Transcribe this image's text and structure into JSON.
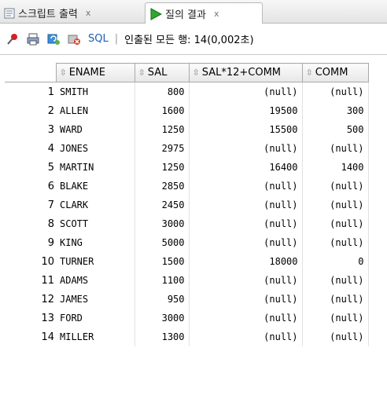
{
  "tabs": [
    {
      "label": "스크립트 출력",
      "close": "x",
      "icon": "script-output-icon"
    },
    {
      "label": "질의 결과",
      "close": "x",
      "icon": "run-icon"
    }
  ],
  "toolbar": {
    "icons": [
      "pin-icon",
      "print-icon",
      "refresh-icon",
      "cancel-icon"
    ],
    "sql_label": "SQL",
    "separator": "|",
    "status": "인출된 모든 행: 14(0,002초)"
  },
  "grid": {
    "columns": [
      "ENAME",
      "SAL",
      "SAL*12+COMM",
      "COMM"
    ],
    "rows": [
      {
        "n": "1",
        "ENAME": "SMITH",
        "SAL": "800",
        "CALC": "(null)",
        "COMM": "(null)"
      },
      {
        "n": "2",
        "ENAME": "ALLEN",
        "SAL": "1600",
        "CALC": "19500",
        "COMM": "300"
      },
      {
        "n": "3",
        "ENAME": "WARD",
        "SAL": "1250",
        "CALC": "15500",
        "COMM": "500"
      },
      {
        "n": "4",
        "ENAME": "JONES",
        "SAL": "2975",
        "CALC": "(null)",
        "COMM": "(null)"
      },
      {
        "n": "5",
        "ENAME": "MARTIN",
        "SAL": "1250",
        "CALC": "16400",
        "COMM": "1400"
      },
      {
        "n": "6",
        "ENAME": "BLAKE",
        "SAL": "2850",
        "CALC": "(null)",
        "COMM": "(null)"
      },
      {
        "n": "7",
        "ENAME": "CLARK",
        "SAL": "2450",
        "CALC": "(null)",
        "COMM": "(null)"
      },
      {
        "n": "8",
        "ENAME": "SCOTT",
        "SAL": "3000",
        "CALC": "(null)",
        "COMM": "(null)"
      },
      {
        "n": "9",
        "ENAME": "KING",
        "SAL": "5000",
        "CALC": "(null)",
        "COMM": "(null)"
      },
      {
        "n": "10",
        "ENAME": "TURNER",
        "SAL": "1500",
        "CALC": "18000",
        "COMM": "0"
      },
      {
        "n": "11",
        "ENAME": "ADAMS",
        "SAL": "1100",
        "CALC": "(null)",
        "COMM": "(null)"
      },
      {
        "n": "12",
        "ENAME": "JAMES",
        "SAL": "950",
        "CALC": "(null)",
        "COMM": "(null)"
      },
      {
        "n": "13",
        "ENAME": "FORD",
        "SAL": "3000",
        "CALC": "(null)",
        "COMM": "(null)"
      },
      {
        "n": "14",
        "ENAME": "MILLER",
        "SAL": "1300",
        "CALC": "(null)",
        "COMM": "(null)"
      }
    ]
  }
}
